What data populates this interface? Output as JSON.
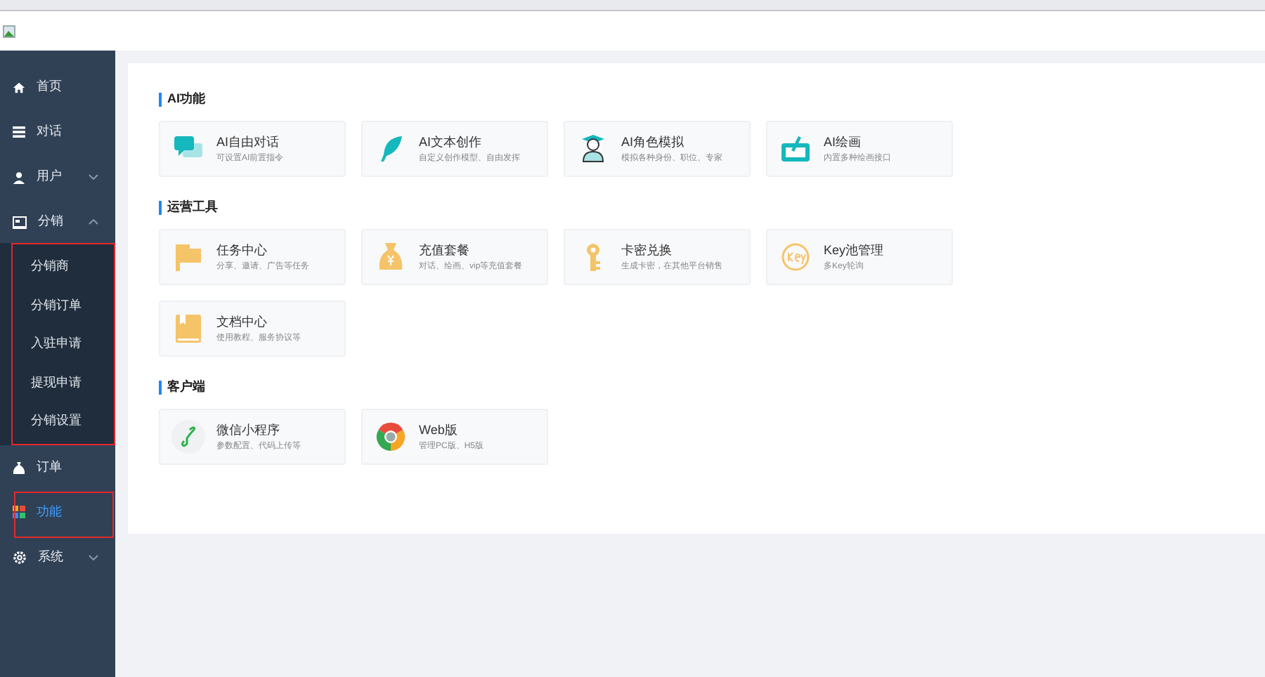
{
  "sidebar": {
    "items": [
      {
        "label": "首页",
        "selected": false
      },
      {
        "label": "对话",
        "selected": false
      },
      {
        "label": "用户",
        "selected": false,
        "expanded": false
      },
      {
        "label": "分销",
        "selected": false,
        "expanded": true,
        "annotated": true,
        "children": [
          {
            "label": "分销商",
            "selected": false
          },
          {
            "label": "分销订单",
            "selected": false
          },
          {
            "label": "入驻申请",
            "selected": false
          },
          {
            "label": "提现申请",
            "selected": false
          },
          {
            "label": "分销设置",
            "selected": false
          }
        ]
      },
      {
        "label": "订单",
        "selected": false
      },
      {
        "label": "功能",
        "selected": true,
        "annotated": true
      },
      {
        "label": "系统",
        "selected": false,
        "expanded": false
      }
    ]
  },
  "sections": [
    {
      "title": "AI功能",
      "cards": [
        {
          "title": "AI自由对话",
          "desc": "可设置AI前置指令"
        },
        {
          "title": "AI文本创作",
          "desc": "自定义创作模型、自由发挥"
        },
        {
          "title": "AI角色模拟",
          "desc": "模拟各种身份、职位、专家"
        },
        {
          "title": "AI绘画",
          "desc": "内置多种绘画接口"
        }
      ]
    },
    {
      "title": "运营工具",
      "cards": [
        {
          "title": "任务中心",
          "desc": "分享、邀请、广告等任务"
        },
        {
          "title": "充值套餐",
          "desc": "对话、绘画、vip等充值套餐"
        },
        {
          "title": "卡密兑换",
          "desc": "生成卡密，在其他平台销售"
        },
        {
          "title": "Key池管理",
          "desc": "多Key轮询"
        },
        {
          "title": "文档中心",
          "desc": "使用教程、服务协议等"
        }
      ]
    },
    {
      "title": "客户端",
      "cards": [
        {
          "title": "微信小程序",
          "desc": "参数配置、代码上传等"
        },
        {
          "title": "Web版",
          "desc": "管理PC版、H5版"
        }
      ]
    }
  ]
}
